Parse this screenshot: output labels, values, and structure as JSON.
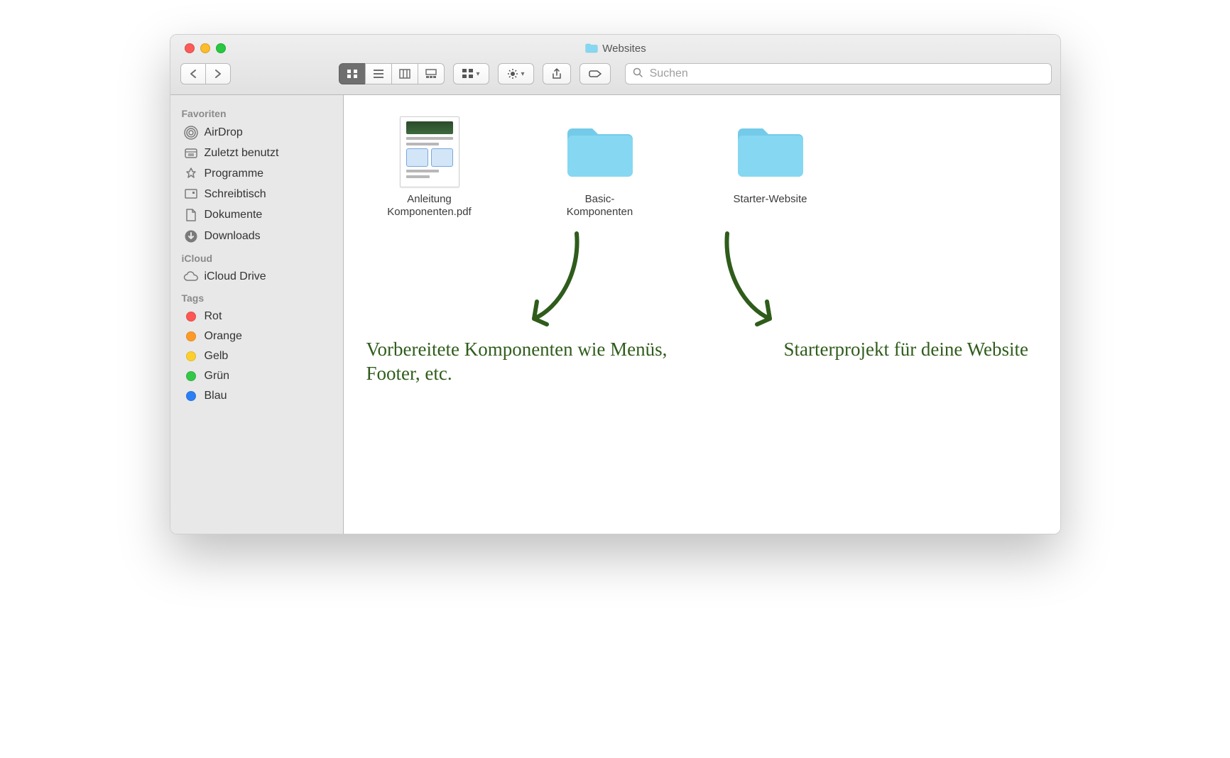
{
  "window": {
    "title": "Websites"
  },
  "toolbar": {
    "search_placeholder": "Suchen"
  },
  "sidebar": {
    "sections": [
      {
        "heading": "Favoriten",
        "items": [
          {
            "label": "AirDrop",
            "icon": "airdrop-icon"
          },
          {
            "label": "Zuletzt benutzt",
            "icon": "recents-icon"
          },
          {
            "label": "Programme",
            "icon": "applications-icon"
          },
          {
            "label": "Schreibtisch",
            "icon": "desktop-icon"
          },
          {
            "label": "Dokumente",
            "icon": "documents-icon"
          },
          {
            "label": "Downloads",
            "icon": "downloads-icon"
          }
        ]
      },
      {
        "heading": "iCloud",
        "items": [
          {
            "label": "iCloud Drive",
            "icon": "icloud-icon"
          }
        ]
      },
      {
        "heading": "Tags",
        "items": [
          {
            "label": "Rot",
            "color": "#fc5753"
          },
          {
            "label": "Orange",
            "color": "#fd9a27"
          },
          {
            "label": "Gelb",
            "color": "#fdcf2d"
          },
          {
            "label": "Grün",
            "color": "#33c748"
          },
          {
            "label": "Blau",
            "color": "#2b7ff4"
          }
        ]
      }
    ]
  },
  "files": [
    {
      "name_l1": "Anleitung",
      "name_l2": "Komponenten.pdf",
      "type": "pdf"
    },
    {
      "name_l1": "Basic-",
      "name_l2": "Komponenten",
      "type": "folder"
    },
    {
      "name_l1": "Starter-Website",
      "name_l2": "",
      "type": "folder"
    }
  ],
  "annotations": {
    "left": "Vorbereitete Komponenten wie Menüs, Footer, etc.",
    "right": "Starterprojekt für deine Website"
  },
  "colors": {
    "annotation_ink": "#2f5c1b",
    "folder_fill": "#86d7f1"
  }
}
